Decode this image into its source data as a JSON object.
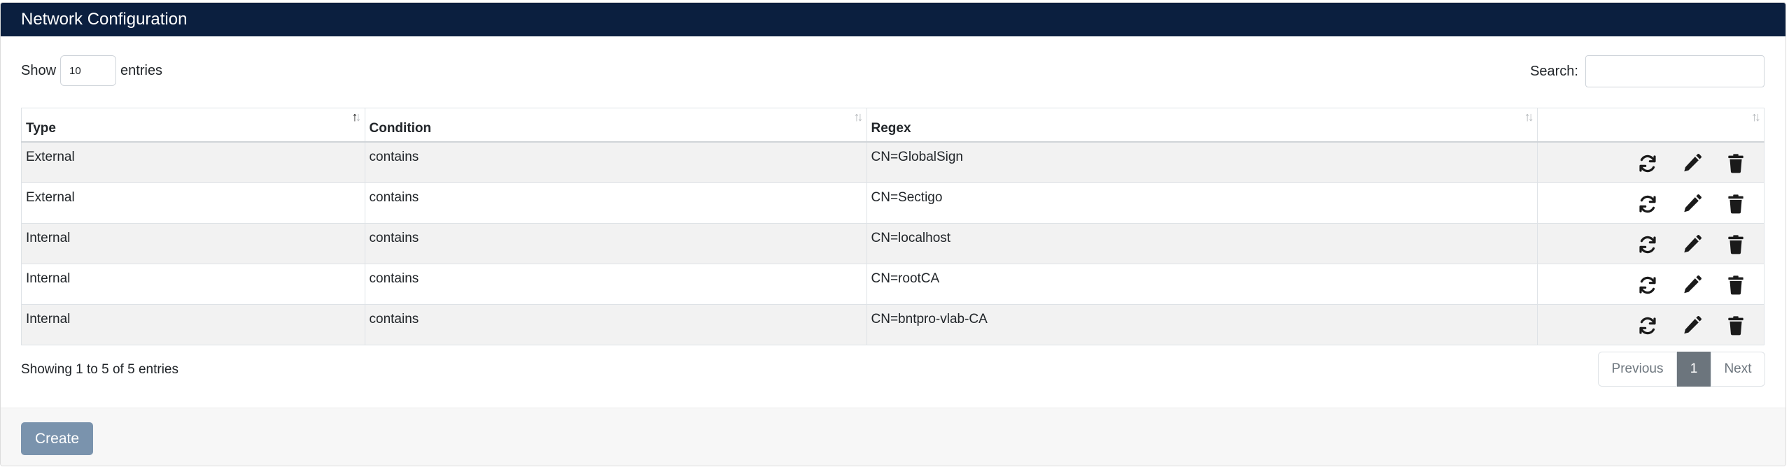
{
  "header": {
    "title": "Network Configuration"
  },
  "controls": {
    "show_label": "Show",
    "entries_value": "10",
    "entries_label": "entries",
    "search_label": "Search:",
    "search_value": ""
  },
  "table": {
    "columns": [
      "Type",
      "Condition",
      "Regex",
      ""
    ],
    "rows": [
      {
        "type": "External",
        "condition": "contains",
        "regex": "CN=GlobalSign"
      },
      {
        "type": "External",
        "condition": "contains",
        "regex": "CN=Sectigo"
      },
      {
        "type": "Internal",
        "condition": "contains",
        "regex": "CN=localhost"
      },
      {
        "type": "Internal",
        "condition": "contains",
        "regex": "CN=rootCA"
      },
      {
        "type": "Internal",
        "condition": "contains",
        "regex": "CN=bntpro-vlab-CA"
      }
    ],
    "row_icons": [
      "refresh-icon",
      "pencil-icon",
      "trash-icon"
    ]
  },
  "footer": {
    "info": "Showing 1 to 5 of 5 entries",
    "prev": "Previous",
    "page": "1",
    "next": "Next"
  },
  "actions": {
    "create": "Create"
  },
  "colors": {
    "header_bg": "#0b1f3f",
    "button_bg": "#7a93ad",
    "active_page": "#6c757d"
  }
}
